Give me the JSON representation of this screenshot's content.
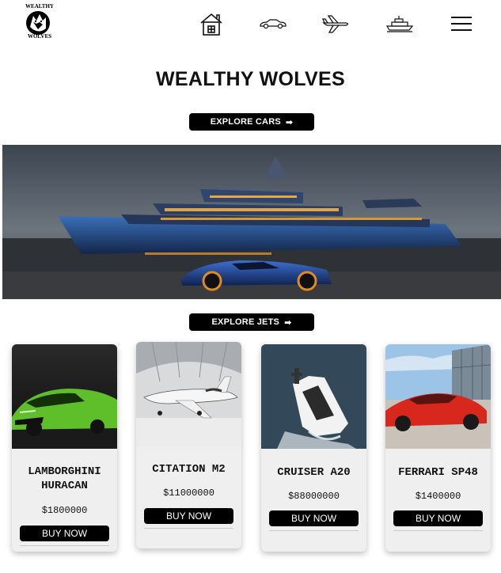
{
  "brand": {
    "logo_text_top": "WEALTHY",
    "logo_text_bottom": "WOLVES"
  },
  "nav": {
    "items": [
      {
        "name": "home-icon"
      },
      {
        "name": "car-icon"
      },
      {
        "name": "jet-icon"
      },
      {
        "name": "yacht-icon"
      },
      {
        "name": "menu-icon"
      }
    ]
  },
  "page_title": "WEALTHY WOLVES",
  "buttons": {
    "explore_cars": "EXPLORE CARS",
    "explore_jets": "EXPLORE JETS",
    "arrow": "➡"
  },
  "products": [
    {
      "name": "LAMBORGHINI HURACAN",
      "price": "$1800000",
      "buy_label": "BUY NOW",
      "image": "green-sports-car"
    },
    {
      "name": "CITATION M2",
      "price": "$11000000",
      "buy_label": "BUY NOW",
      "image": "private-jet-hangar"
    },
    {
      "name": "CRUISER A20",
      "price": "$88000000",
      "buy_label": "BUY NOW",
      "image": "yacht-ocean"
    },
    {
      "name": "FERRARI SP48",
      "price": "$1400000",
      "buy_label": "BUY NOW",
      "image": "red-sports-car"
    }
  ],
  "colors": {
    "accent": "#000000",
    "card_bg": "#efefef",
    "text": "#111111"
  }
}
